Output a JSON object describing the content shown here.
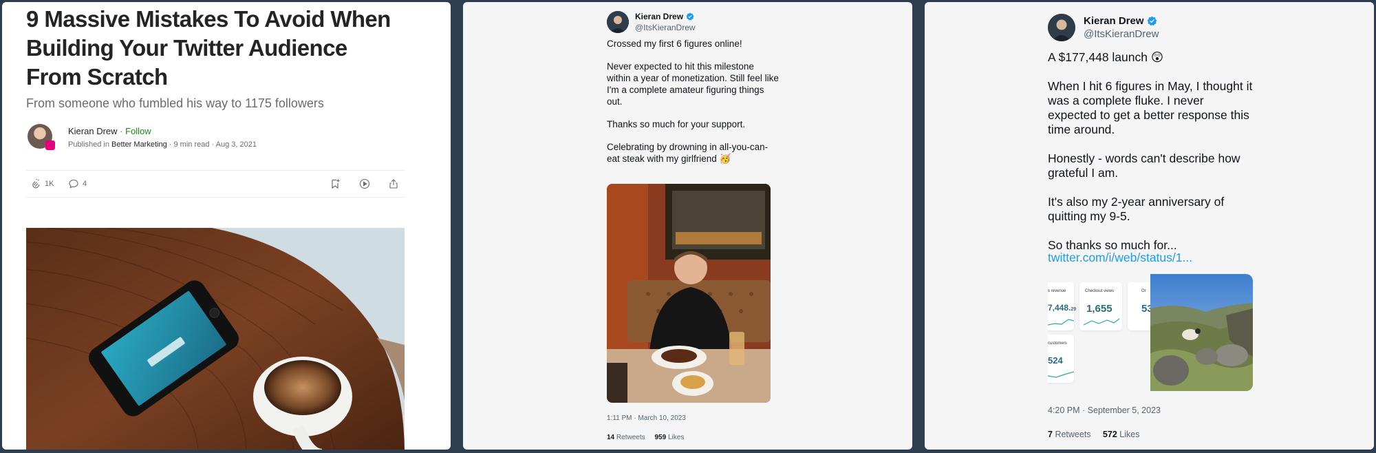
{
  "article": {
    "title_lines": [
      "9 Massive Mistakes To Avoid When",
      "Building Your Twitter Audience",
      "From Scratch"
    ],
    "subtitle": "From someone who fumbled his way to 1175 followers",
    "author": "Kieran Drew",
    "follow": "Follow",
    "published_prefix": "Published in",
    "publication": "Better Marketing",
    "read_time": "9 min read",
    "date": "Aug 3, 2021",
    "claps": "1K",
    "responses": "4",
    "icons": [
      "clap-icon",
      "comment-icon",
      "bookmark-icon",
      "play-icon",
      "share-icon"
    ]
  },
  "tweet1": {
    "name": "Kieran Drew",
    "handle": "@ItsKieranDrew",
    "text": "Crossed my first 6 figures online!\n\nNever expected to hit this milestone within a year of monetization. Still feel like I'm a complete amateur figuring things out.\n\nThanks so much for your support.\n\nCelebrating by drowning in all-you-can-eat steak with my girlfriend 🥳",
    "time": "1:11 PM · March 10, 2023",
    "retweets": "14",
    "retweets_label": "Retweets",
    "likes": "959",
    "likes_label": "Likes"
  },
  "tweet2": {
    "name": "Kieran Drew",
    "handle": "@ItsKieranDrew",
    "text": "A $177,448 launch 😲\n\nWhen I hit 6 figures in May, I thought it was a complete fluke. I never expected to get a better response this time around.\n\nHonestly - words can't describe how grateful I am.\n\nIt's also my 2-year anniversary of quitting my 9-5.\n\nSo thanks so much for...",
    "link": "twitter.com/i/web/status/1...",
    "time": "4:20 PM · September 5, 2023",
    "retweets": "7",
    "retweets_label": "Retweets",
    "likes": "572",
    "likes_label": "Likes",
    "cards": [
      {
        "label": "s revenue",
        "value": "7,448.",
        "value_suffix": "29"
      },
      {
        "label": "Checkout views",
        "value": "1,655"
      },
      {
        "label": "Or",
        "value": "53"
      },
      {
        "label": "customers",
        "value": "524"
      }
    ]
  },
  "colors": {
    "frame": "#2c3e50",
    "medium_green": "#1a8917",
    "twitter_blue": "#1d9bf0",
    "verified_blue": "#1d9bf0",
    "stat_teal": "#2a6b7a"
  }
}
